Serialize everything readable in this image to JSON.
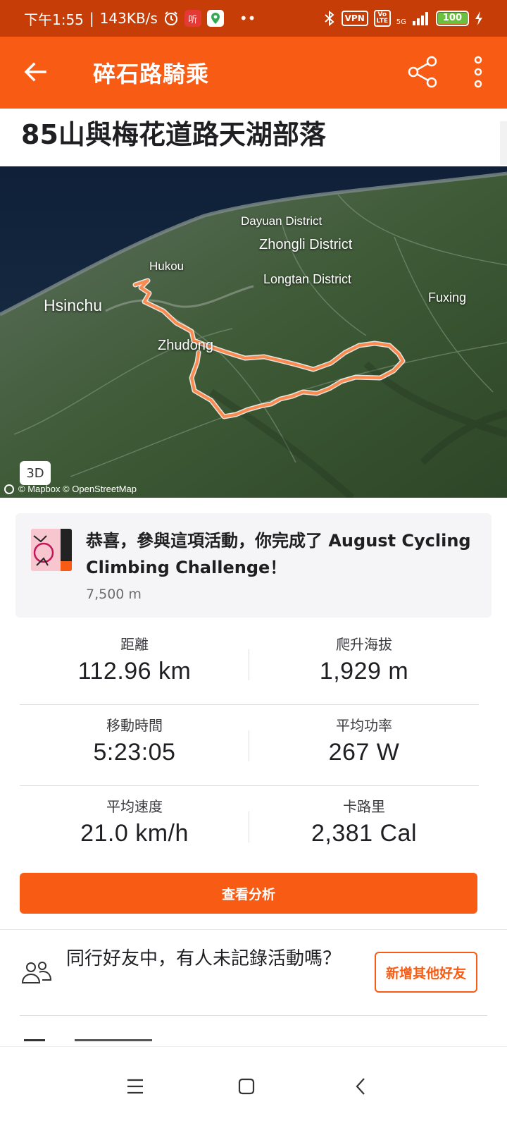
{
  "status_bar": {
    "time": "下午1:55",
    "network_speed": "143KB/s",
    "app_icon_red": "听",
    "dots": "••",
    "vpn": "VPN",
    "volte": "Vo LTE",
    "signal": "5G",
    "battery": "100"
  },
  "appbar": {
    "title": "碎石路騎乘",
    "back_icon": "arrow-left-icon",
    "share_icon": "share-icon",
    "more_icon": "more-vertical-icon"
  },
  "activity": {
    "title": "85山與梅花道路天湖部落"
  },
  "map": {
    "labels": {
      "dayuan": "Dayuan District",
      "zhongli": "Zhongli District",
      "hukou": "Hukou",
      "longtan": "Longtan District",
      "hsinchu": "Hsinchu",
      "fuxing": "Fuxing",
      "zhudong": "Zhudong"
    },
    "toggle_3d": "3D",
    "attribution": "© Mapbox © OpenStreetMap",
    "route_color": "#fc8a4e"
  },
  "challenge": {
    "text": "恭喜，參與這項活動，你完成了 August Cycling Climbing Challenge！",
    "subtitle": "7,500 m"
  },
  "stats": {
    "distance": {
      "label": "距離",
      "value": "112.96 km"
    },
    "elevation": {
      "label": "爬升海拔",
      "value": "1,929 m"
    },
    "moving_time": {
      "label": "移動時間",
      "value": "5:23:05"
    },
    "avg_power": {
      "label": "平均功率",
      "value": "267 W"
    },
    "avg_speed": {
      "label": "平均速度",
      "value": "21.0 km/h"
    },
    "calories": {
      "label": "卡路里",
      "value": "2,381 Cal"
    }
  },
  "analysis_button": "查看分析",
  "friends": {
    "text": "同行好友中，有人未記錄活動嗎？",
    "add_button": "新增其他好友"
  },
  "colors": {
    "brand": "#f85b14",
    "status_bar": "#c63d08"
  }
}
